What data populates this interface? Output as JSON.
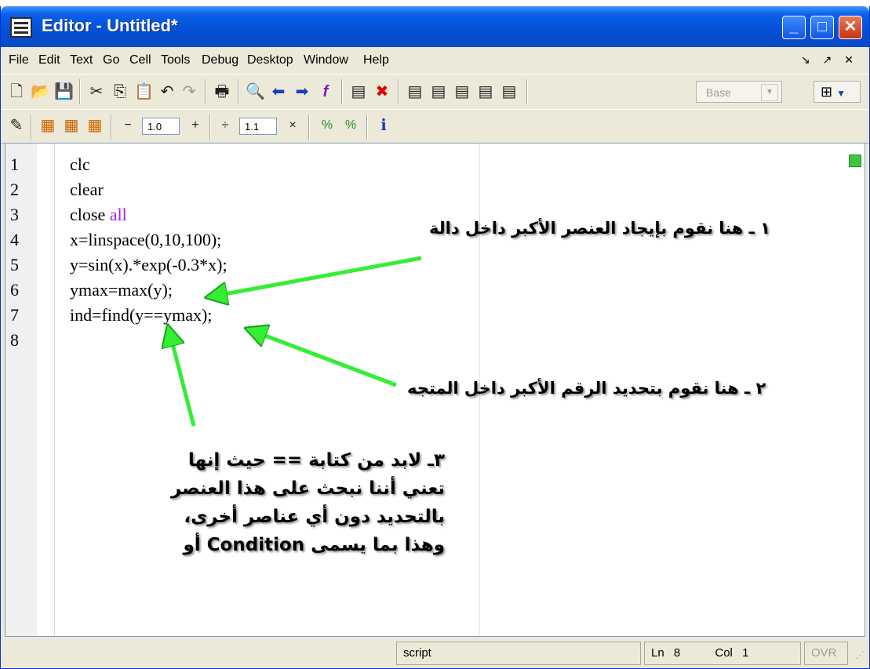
{
  "window": {
    "title": "Editor - Untitled*",
    "min": "_",
    "max": "□",
    "close": "✕"
  },
  "menu": [
    "File",
    "Edit",
    "Text",
    "Go",
    "Cell",
    "Tools",
    "Debug",
    "Desktop",
    "Window",
    "Help"
  ],
  "menu_right": "↘ ↗ ✕",
  "toolbar": {
    "stack_combo": "Base"
  },
  "cell_toolbar": {
    "decrement": "−",
    "value1": "1.0",
    "increment": "+",
    "divide": "÷",
    "value2": "1.1",
    "multiply": "×"
  },
  "editor": {
    "line_numbers": [
      "1",
      "2",
      "3",
      "4",
      "5",
      "6",
      "7",
      "8"
    ],
    "lines": [
      {
        "text": "clc"
      },
      {
        "text": "clear"
      },
      {
        "text": "close ",
        "kw": "all"
      },
      {
        "text": "x=linspace(0,10,100);"
      },
      {
        "text": "y=sin(x).*exp(-0.3*x);"
      },
      {
        "text": "ymax=max(y);"
      },
      {
        "text": "ind=find(y==ymax);"
      },
      {
        "text": ""
      }
    ]
  },
  "annotations": {
    "a1": "١ ـ هنا نقوم بإيجاد العنصر الأكبر داخل دالة",
    "a2": "٢ ـ هنا نقوم بتحديد الرقم الأكبر داخل المتجه",
    "a3_lines": [
      "٣ـ لابد من كتابة == حيث إنها",
      "تعني أننا نبحث على هذا العنصر",
      "بالتحديد دون أي عناصر أخرى،",
      "وهذا بما يسمى Condition أو"
    ],
    "arrow_color": "#33ee33"
  },
  "status": {
    "mode": "script",
    "ln_label": "Ln",
    "ln": "8",
    "col_label": "Col",
    "col": "1",
    "ovr": "OVR"
  }
}
